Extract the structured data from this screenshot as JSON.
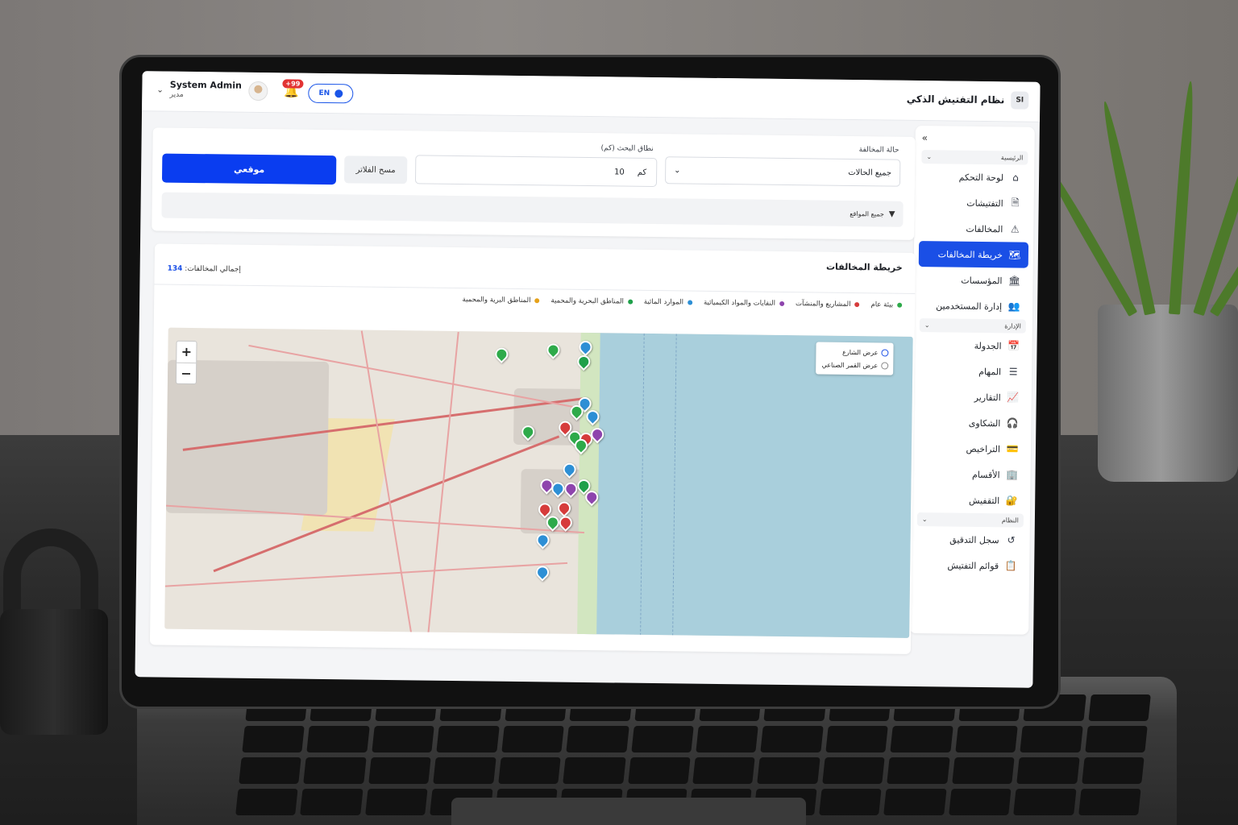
{
  "app": {
    "title": "نظام التفتيش الذكي",
    "badge": "SI"
  },
  "header": {
    "user_name": "System Admin",
    "user_role": "مدير",
    "notifications": "+99",
    "language": "EN"
  },
  "sidebar": {
    "sections": [
      {
        "title": "الرئيسية",
        "items": [
          "لوحة التحكم",
          "التفتيشات",
          "المخالفات",
          "خريطة المخالفات",
          "المؤسسات",
          "إدارة المستخدمين"
        ]
      },
      {
        "title": "الإدارة",
        "items": [
          "الجدولة",
          "المهام",
          "التقارير",
          "الشكاوى",
          "التراخيص",
          "الأقسام",
          "التقفيش"
        ]
      },
      {
        "title": "النظام",
        "items": [
          "سجل التدقيق",
          "قوائم التفتيش"
        ]
      }
    ],
    "active_item": "خريطة المخالفات"
  },
  "filters": {
    "status_label": "حالة المخالفة",
    "status_value": "جميع الحالات",
    "range_label": "نطاق البحث (كم)",
    "range_value": "10",
    "range_unit": "كم",
    "clear_label": "مسح الفلاتر",
    "locate_label": "موقعي",
    "all_sites_label": "جميع المواقع"
  },
  "map_card": {
    "title": "خريطة المخالفات",
    "total_label": "إجمالي المخالفات:",
    "total_value": "134",
    "legend": [
      {
        "label": "بيئة عام",
        "color": "#2eaa4a"
      },
      {
        "label": "المشاريع والمنشآت",
        "color": "#d63b3b"
      },
      {
        "label": "النفايات والمواد الكيميائية",
        "color": "#8e44ad"
      },
      {
        "label": "الموارد المائية",
        "color": "#2d8fd5"
      },
      {
        "label": "المناطق البحرية والمحمية",
        "color": "#1fa04a"
      },
      {
        "label": "المناطق البرية والمحمية",
        "color": "#e6a21a"
      }
    ],
    "zoom_in": "+",
    "zoom_out": "−",
    "layers": [
      "عرض الشارع",
      "عرض القمر الصناعي"
    ]
  }
}
